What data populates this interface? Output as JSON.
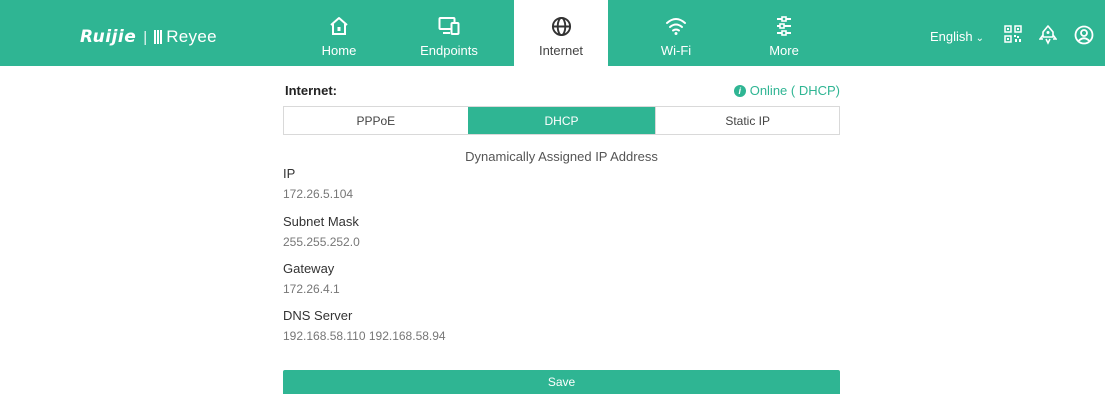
{
  "brand": {
    "name_primary": "Ruijie",
    "separator": "|",
    "name_secondary": "Reyee"
  },
  "nav": {
    "items": [
      {
        "label": "Home",
        "icon": "home-icon",
        "active": false
      },
      {
        "label": "Endpoints",
        "icon": "devices-icon",
        "active": false
      },
      {
        "label": "Internet",
        "icon": "globe-icon",
        "active": true
      },
      {
        "label": "Wi-Fi",
        "icon": "wifi-icon",
        "active": false
      },
      {
        "label": "More",
        "icon": "sliders-icon",
        "active": false
      }
    ]
  },
  "header_tools": {
    "language": "English",
    "qr_icon": "qr-code-icon",
    "rocket_icon": "rocket-icon",
    "account_icon": "user-icon"
  },
  "internet": {
    "section_label": "Internet:",
    "status_text": "Online ( DHCP)",
    "tabs": [
      "PPPoE",
      "DHCP",
      "Static IP"
    ],
    "selected_tab": "DHCP",
    "description": "Dynamically Assigned IP Address",
    "fields": [
      {
        "label": "IP",
        "value": "172.26.5.104"
      },
      {
        "label": "Subnet Mask",
        "value": "255.255.252.0"
      },
      {
        "label": "Gateway",
        "value": "172.26.4.1"
      },
      {
        "label": "DNS Server",
        "value": "192.168.58.110 192.168.58.94"
      }
    ],
    "save_label": "Save"
  },
  "colors": {
    "accent": "#2fb593",
    "text": "#333333",
    "muted": "#777777",
    "border": "#d9d9d9"
  }
}
